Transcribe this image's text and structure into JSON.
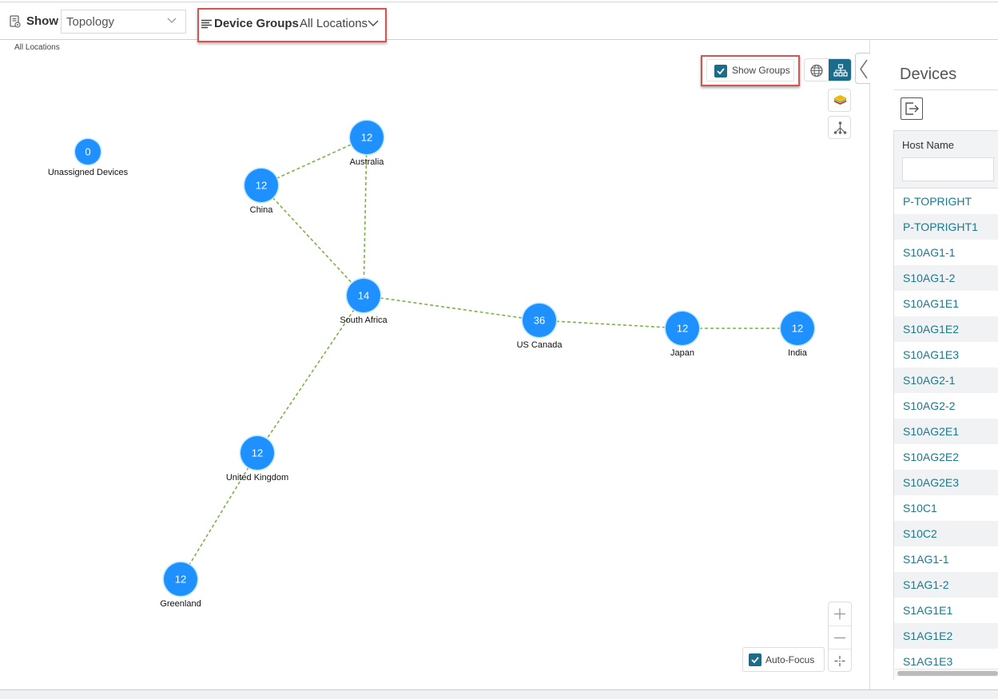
{
  "toolbar": {
    "show_label": "Show",
    "show_select_value": "Topology",
    "device_groups_label": "Device Groups",
    "device_groups_value": "All Locations"
  },
  "breadcrumb": "All Locations",
  "controls": {
    "show_groups_label": "Show Groups",
    "show_groups_checked": true,
    "auto_focus_label": "Auto-Focus",
    "auto_focus_checked": true,
    "active_view": "topology"
  },
  "topology": {
    "node_color": "#1e90ff",
    "link_color": "#7cb342",
    "nodes": [
      {
        "id": "unassigned",
        "label": "Unassigned Devices",
        "count": "0"
      },
      {
        "id": "australia",
        "label": "Australia",
        "count": "12"
      },
      {
        "id": "china",
        "label": "China",
        "count": "12"
      },
      {
        "id": "south-africa",
        "label": "South Africa",
        "count": "14"
      },
      {
        "id": "us-canada",
        "label": "US Canada",
        "count": "36"
      },
      {
        "id": "japan",
        "label": "Japan",
        "count": "12"
      },
      {
        "id": "india",
        "label": "India",
        "count": "12"
      },
      {
        "id": "united-kingdom",
        "label": "United Kingdom",
        "count": "12"
      },
      {
        "id": "greenland",
        "label": "Greenland",
        "count": "12"
      }
    ],
    "links": [
      [
        "china",
        "australia"
      ],
      [
        "china",
        "south-africa"
      ],
      [
        "australia",
        "south-africa"
      ],
      [
        "south-africa",
        "us-canada"
      ],
      [
        "us-canada",
        "japan"
      ],
      [
        "japan",
        "india"
      ],
      [
        "south-africa",
        "united-kingdom"
      ],
      [
        "united-kingdom",
        "greenland"
      ]
    ]
  },
  "devices_panel": {
    "title": "Devices",
    "column_header": "Host Name",
    "filter_value": "",
    "rows": [
      "P-TOPRIGHT",
      "P-TOPRIGHT1",
      "S10AG1-1",
      "S10AG1-2",
      "S10AG1E1",
      "S10AG1E2",
      "S10AG1E3",
      "S10AG2-1",
      "S10AG2-2",
      "S10AG2E1",
      "S10AG2E2",
      "S10AG2E3",
      "S10C1",
      "S10C2",
      "S1AG1-1",
      "S1AG1-2",
      "S1AG1E1",
      "S1AG1E2",
      "S1AG1E3"
    ]
  },
  "colors": {
    "accent": "#1b6b8a",
    "highlight_border": "#d9534f",
    "link_text": "#1b7a8f"
  }
}
